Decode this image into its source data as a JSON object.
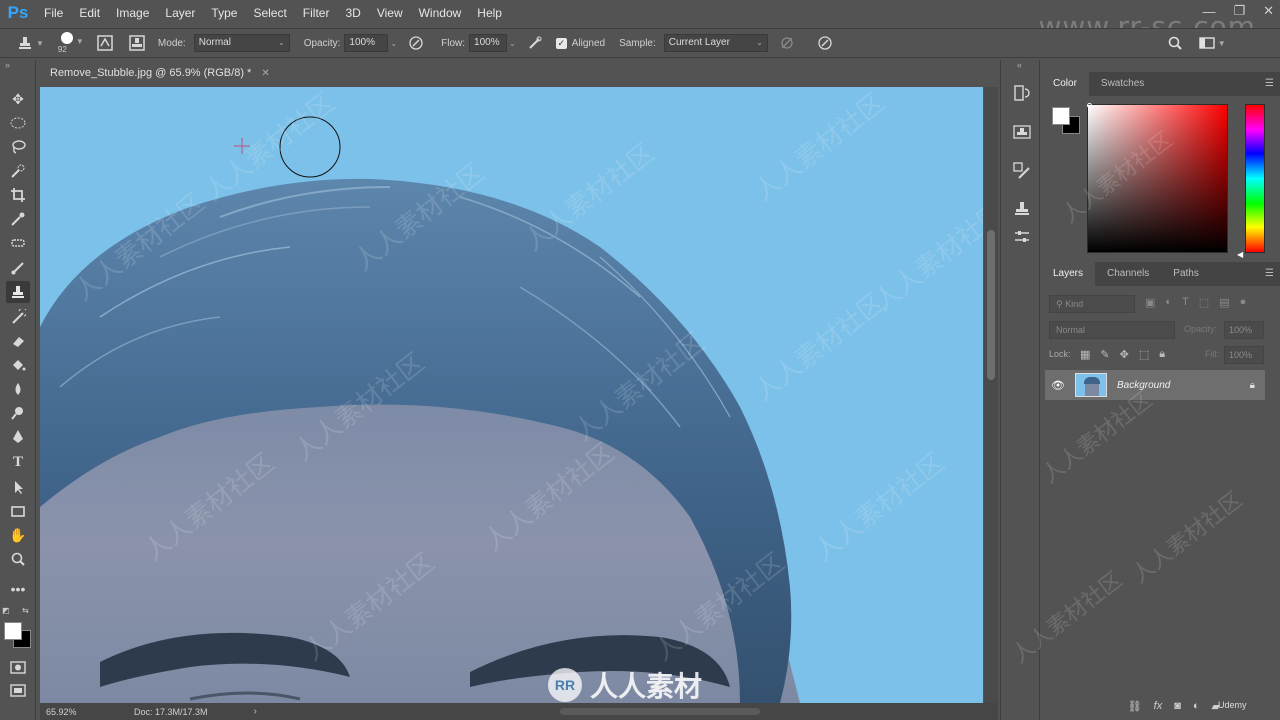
{
  "app": {
    "logo": "Ps",
    "menu": [
      "File",
      "Edit",
      "Image",
      "Layer",
      "Type",
      "Select",
      "Filter",
      "3D",
      "View",
      "Window",
      "Help"
    ],
    "window_controls": [
      "—",
      "❐",
      "✕"
    ],
    "watermark_url": "www.rr-sc.com"
  },
  "options": {
    "brush_size": "92",
    "mode_label": "Mode:",
    "mode_value": "Normal",
    "opacity_label": "Opacity:",
    "opacity_value": "100%",
    "flow_label": "Flow:",
    "flow_value": "100%",
    "aligned_label": "Aligned",
    "sample_label": "Sample:",
    "sample_value": "Current Layer"
  },
  "document": {
    "tab_title": "Remove_Stubble.jpg @ 65.9% (RGB/8) *",
    "zoom": "65.92%",
    "doc_info": "Doc: 17.3M/17.3M",
    "center_watermark": "人人素材"
  },
  "panels": {
    "color_tabs": [
      "Color",
      "Swatches"
    ],
    "layers_tabs": [
      "Layers",
      "Channels",
      "Paths"
    ],
    "kind_placeholder": "Kind",
    "blend_mode": "Normal",
    "opacity_label": "Opacity:",
    "opacity_value": "100%",
    "lock_label": "Lock:",
    "fill_label": "Fill:",
    "fill_value": "100%",
    "layer_name": "Background",
    "udemy": "Udemy"
  },
  "colors": {
    "accent": "#31a8ff",
    "canvas_bg": "#7cc1e9",
    "ui_bg": "#535353"
  }
}
